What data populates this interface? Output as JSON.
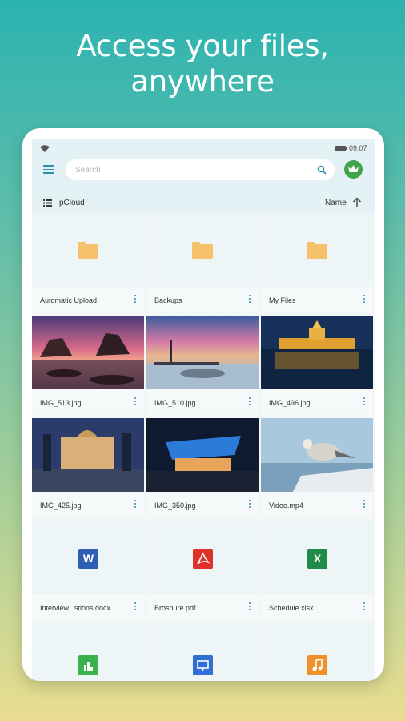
{
  "headline": {
    "line1": "Access your files,",
    "line2": "anywhere"
  },
  "status_bar": {
    "time": "09:07"
  },
  "search": {
    "placeholder": "Search"
  },
  "path": {
    "label": "pCloud"
  },
  "sort": {
    "label": "Name",
    "direction": "ascending"
  },
  "colors": {
    "accent": "#2c8faf",
    "fab": "#16909a",
    "folder": "#f5c26b",
    "avatar": "#3fa34d"
  },
  "items": [
    {
      "name": "Automatic Upload",
      "kind": "folder"
    },
    {
      "name": "Backups",
      "kind": "folder"
    },
    {
      "name": "My Files",
      "kind": "folder"
    },
    {
      "name": "IMG_513.jpg",
      "kind": "photo"
    },
    {
      "name": "IMG_510.jpg",
      "kind": "photo"
    },
    {
      "name": "IMG_496.jpg",
      "kind": "photo"
    },
    {
      "name": "IMG_425.jpg",
      "kind": "photo"
    },
    {
      "name": "IMG_350.jpg",
      "kind": "photo"
    },
    {
      "name": "Video.mp4",
      "kind": "video"
    },
    {
      "name": "Interview...stions.docx",
      "kind": "word",
      "badge": "W"
    },
    {
      "name": "Broshure.pdf",
      "kind": "pdf"
    },
    {
      "name": "Schedule.xlsx",
      "kind": "excel",
      "badge": "X"
    },
    {
      "name": "",
      "kind": "chart"
    },
    {
      "name": "",
      "kind": "presentation"
    },
    {
      "name": "",
      "kind": "audio"
    }
  ],
  "fab": {
    "label": "+"
  }
}
